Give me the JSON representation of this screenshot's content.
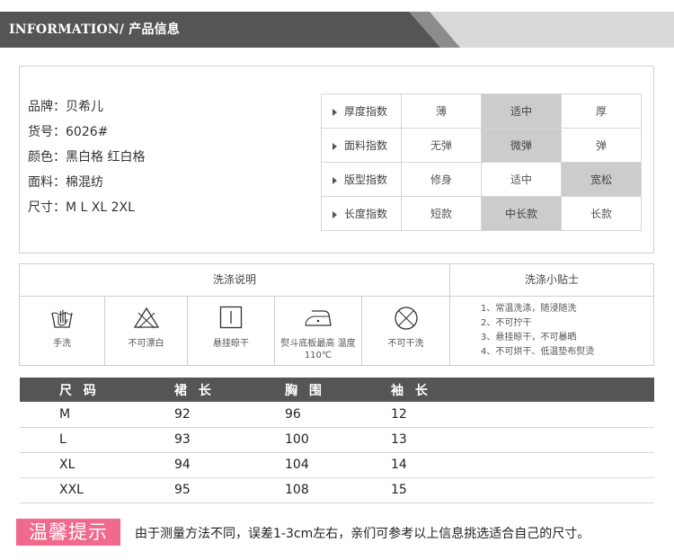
{
  "header": {
    "title": "INFORMATION/ 产品信息"
  },
  "info": {
    "lines": [
      "品牌：贝希儿",
      "货号：6026#",
      "颜色：黑白格 红白格",
      "面料：棉混纺",
      "尺寸：M  L  XL 2XL"
    ]
  },
  "indices": [
    {
      "label": "厚度指数",
      "options": [
        "薄",
        "适中",
        "厚"
      ],
      "selected": 1
    },
    {
      "label": "面料指数",
      "options": [
        "无弹",
        "微弹",
        "弹"
      ],
      "selected": 1
    },
    {
      "label": "版型指数",
      "options": [
        "修身",
        "适中",
        "宽松"
      ],
      "selected": 2
    },
    {
      "label": "长度指数",
      "options": [
        "短款",
        "中长款",
        "长款"
      ],
      "selected": 1
    }
  ],
  "wash": {
    "title": "洗涤说明",
    "tips_title": "洗涤小贴士",
    "icons": [
      {
        "icon": "hand-wash-icon",
        "label": "手洗"
      },
      {
        "icon": "no-bleach-icon",
        "label": "不可漂白"
      },
      {
        "icon": "hang-dry-icon",
        "label": "悬挂晾干"
      },
      {
        "icon": "iron-icon",
        "label": "熨斗底板最高 温度110℃"
      },
      {
        "icon": "no-dry-clean-icon",
        "label": "不可干洗"
      }
    ],
    "tips": [
      "1、常温洗涤，随浸随洗",
      "2、不可拧干",
      "3、悬挂晾干，不可暴晒",
      "4、不可烘干、低温垫布熨烫"
    ]
  },
  "size_table": {
    "headers": [
      "尺 码",
      "裙 长",
      "胸 围",
      "袖 长"
    ],
    "rows": [
      [
        "M",
        "92",
        "96",
        "12"
      ],
      [
        "L",
        "93",
        "100",
        "13"
      ],
      [
        "XL",
        "94",
        "104",
        "14"
      ],
      [
        "XXL",
        "95",
        "108",
        "15"
      ]
    ]
  },
  "notice": {
    "badge": "温馨提示",
    "text": "由于测量方法不同，误差1-3cm左右，亲们可参考以上信息挑选适合自己的尺寸。"
  },
  "colors": {
    "header_dark": "#555555",
    "selected_cell": "#cccccc",
    "badge": "#ef6a8c"
  }
}
